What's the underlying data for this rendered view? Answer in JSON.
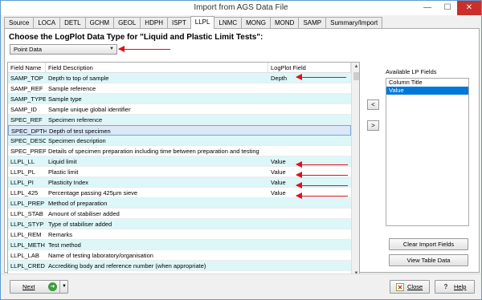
{
  "window": {
    "title": "Import from AGS Data File"
  },
  "tabs": [
    "Source",
    "LOCA",
    "DETL",
    "GCHM",
    "GEOL",
    "HDPH",
    "ISPT",
    "LLPL",
    "LNMC",
    "MONG",
    "MOND",
    "SAMP",
    "Summary/Import"
  ],
  "active_tab": "LLPL",
  "heading": "Choose the LogPlot Data Type for \"Liquid and Plastic Limit Tests\":",
  "data_type": {
    "selected": "Point Data"
  },
  "table": {
    "headers": [
      "Field Name",
      "Field Description",
      "LogPlot Field"
    ],
    "rows": [
      [
        "SAMP_TOP",
        "Depth to top of sample",
        "Depth"
      ],
      [
        "SAMP_REF",
        "Sample reference",
        ""
      ],
      [
        "SAMP_TYPE",
        "Sample type",
        ""
      ],
      [
        "SAMP_ID",
        "Sample unique global identifier",
        ""
      ],
      [
        "SPEC_REF",
        "Specimen reference",
        ""
      ],
      [
        "SPEC_DPTH",
        "Depth of test specimen",
        ""
      ],
      [
        "SPEC_DESC",
        "Specimen description",
        ""
      ],
      [
        "SPEC_PREP",
        "Details of specimen preparation including time between preparation and testing",
        ""
      ],
      [
        "LLPL_LL",
        "Liquid limit",
        "Value"
      ],
      [
        "LLPL_PL",
        "Plastic limit",
        "Value"
      ],
      [
        "LLPL_PI",
        "Plasticity Index",
        "Value"
      ],
      [
        "LLPL_425",
        "Percentage passing 425µm sieve",
        "Value"
      ],
      [
        "LLPL_PREP",
        "Method of preparation",
        ""
      ],
      [
        "LLPL_STAB",
        "Amount of stabiliser added",
        ""
      ],
      [
        "LLPL_STYP",
        "Type of stabiliser added",
        ""
      ],
      [
        "LLPL_REM",
        "Remarks",
        ""
      ],
      [
        "LLPL_METH",
        "Test method",
        ""
      ],
      [
        "LLPL_LAB",
        "Name of testing laboratory/organisation",
        ""
      ],
      [
        "LLPL_CRED",
        "Accrediting body and reference number (when appropriate)",
        ""
      ]
    ],
    "selected_row": 5
  },
  "available_fields": {
    "label": "Available LP Fields",
    "items": [
      "Column Title",
      "Value"
    ],
    "selected": 1
  },
  "buttons": {
    "move_left": "<",
    "move_right": ">",
    "clear_import": "Clear Import Fields",
    "view_table": "View Table Data",
    "next": "Next",
    "close": "Close",
    "help": "Help"
  },
  "colors": {
    "annotation_arrow": "#d9121e",
    "row_stripe": "#ddf6f8",
    "selection": "#0078d7"
  }
}
